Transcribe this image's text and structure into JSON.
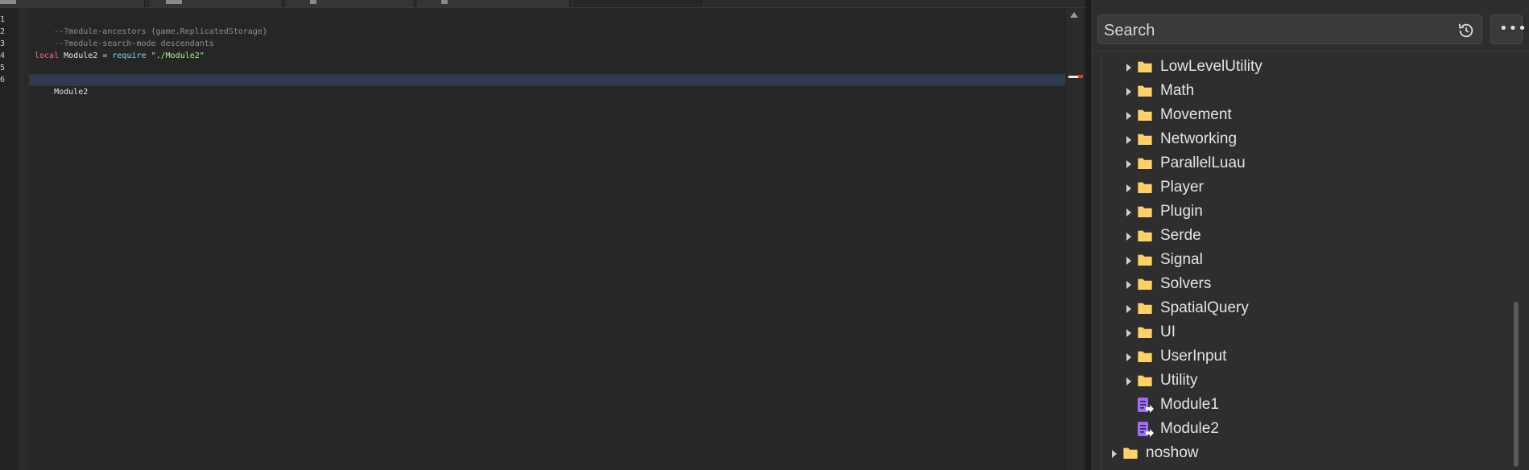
{
  "editor": {
    "line_numbers": [
      "1",
      "2",
      "3",
      "4",
      "5",
      "6"
    ],
    "lines": {
      "l1": "--?module-ancestors {game.ReplicatedStorage}",
      "l2": "--?module-search-mode descendants",
      "l4_keyword": "local",
      "l4_ident": "Module2",
      "l4_op": "=",
      "l4_func": "require",
      "l4_string": "\"./Module2\"",
      "l6": "Module2"
    },
    "colors": {
      "comment": "#8f8f8f",
      "keyword": "#f86d7c",
      "function": "#84d6f7",
      "string": "#adf195"
    }
  },
  "explorer": {
    "search": {
      "placeholder": "Search"
    },
    "history_icon": "history-icon",
    "more_icon": "ellipsis-icon",
    "folders": [
      "LowLevelUtility",
      "Math",
      "Movement",
      "Networking",
      "ParallelLuau",
      "Player",
      "Plugin",
      "Serde",
      "Signal",
      "Solvers",
      "SpatialQuery",
      "UI",
      "UserInput",
      "Utility"
    ],
    "modules": [
      "Module1",
      "Module2"
    ],
    "root_folder": "noshow",
    "folder_color": "#ffd166",
    "module_color": "#a06bff"
  }
}
